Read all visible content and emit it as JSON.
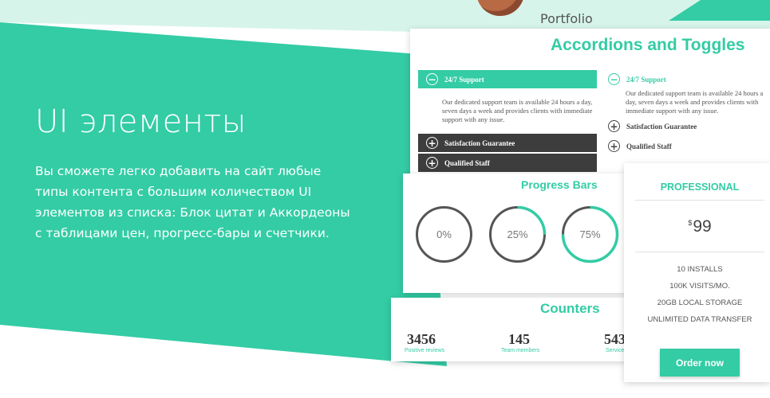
{
  "hero": {
    "title": "UI элементы",
    "description": "Вы сможете легко добавить на сайт любые типы контента с большим количеством UI элементов из списка: Блок цитат и Аккордеоны с таблицами цен, прогресс-бары и счетчики."
  },
  "nav": {
    "portfolio_label": "Portfolio"
  },
  "accordions": {
    "title": "Accordions and Toggles",
    "left": [
      {
        "label": "24/7 Support",
        "icon": "minus-circle-icon",
        "state": "open"
      },
      {
        "label": "Satisfaction Guarantee",
        "icon": "plus-circle-icon",
        "state": "closed"
      },
      {
        "label": "Qualified Staff",
        "icon": "plus-circle-icon",
        "state": "closed"
      }
    ],
    "right": [
      {
        "label": "24/7 Support",
        "icon": "minus-circle-icon",
        "state": "open"
      },
      {
        "label": "Satisfaction Guarantee",
        "icon": "plus-circle-icon",
        "state": "closed"
      },
      {
        "label": "Qualified Staff",
        "icon": "plus-circle-icon",
        "state": "closed"
      }
    ],
    "body_text": "Our dedicated support team is available 24 hours a day, seven days a week and provides clients with immediate support with any issue.",
    "colors": {
      "accent": "#33cca5",
      "dark": "#3d3d3d"
    }
  },
  "progress": {
    "title": "Progress Bars",
    "items": [
      {
        "label": "0%",
        "value": 0
      },
      {
        "label": "25%",
        "value": 0.25
      },
      {
        "label": "75%",
        "value": 0.75
      }
    ],
    "colors": {
      "track": "#555555",
      "fill": "#33cca5"
    }
  },
  "counters": {
    "title": "Counters",
    "items": [
      {
        "value": "3456",
        "label": "Positive reviews"
      },
      {
        "value": "145",
        "label": "Team members"
      },
      {
        "value": "543",
        "label": "Services"
      }
    ]
  },
  "pricing": {
    "plan": "PROFESSIONAL",
    "currency": "$",
    "price": "99",
    "features": [
      "10 INSTALLS",
      "100K VISITS/MO.",
      "20GB LOCAL STORAGE",
      "UNLIMITED DATA TRANSFER"
    ],
    "button_label": "Order now"
  },
  "colors": {
    "brand": "#33cca5",
    "mint": "#d6f4ea",
    "text_dark": "#444444"
  }
}
